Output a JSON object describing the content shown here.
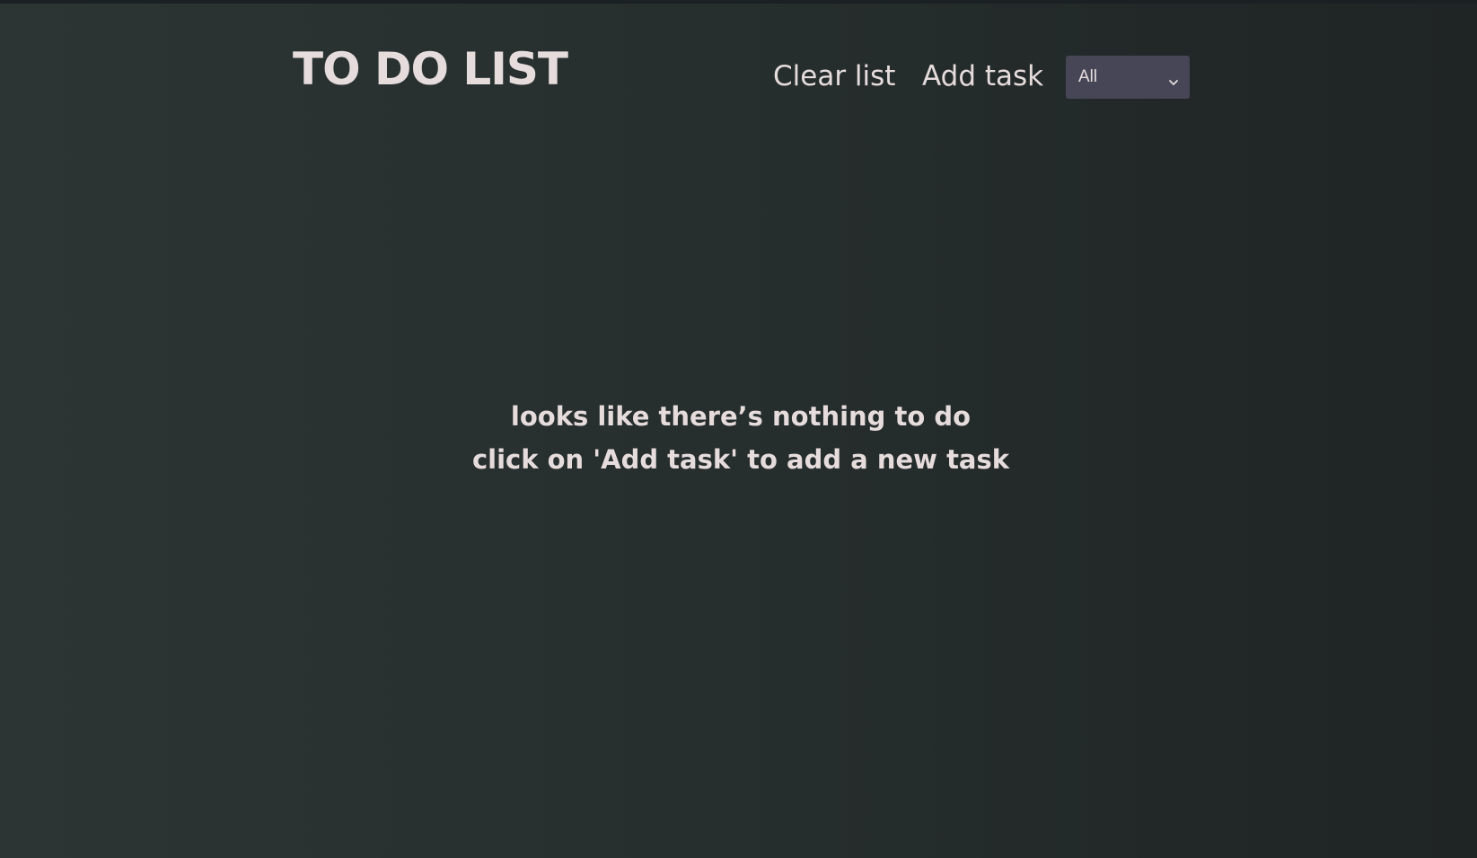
{
  "header": {
    "title": "TO DO LIST",
    "clear_label": "Clear list",
    "add_label": "Add task",
    "filter": {
      "selected": "All",
      "icon": "chevron-down-icon"
    }
  },
  "empty_state": {
    "line1": "looks like there’s nothing to do",
    "line2": "click on 'Add task' to add a new task"
  },
  "colors": {
    "background": "#2a3131",
    "text": "#e6dcdc",
    "select_bg": "#464656"
  }
}
